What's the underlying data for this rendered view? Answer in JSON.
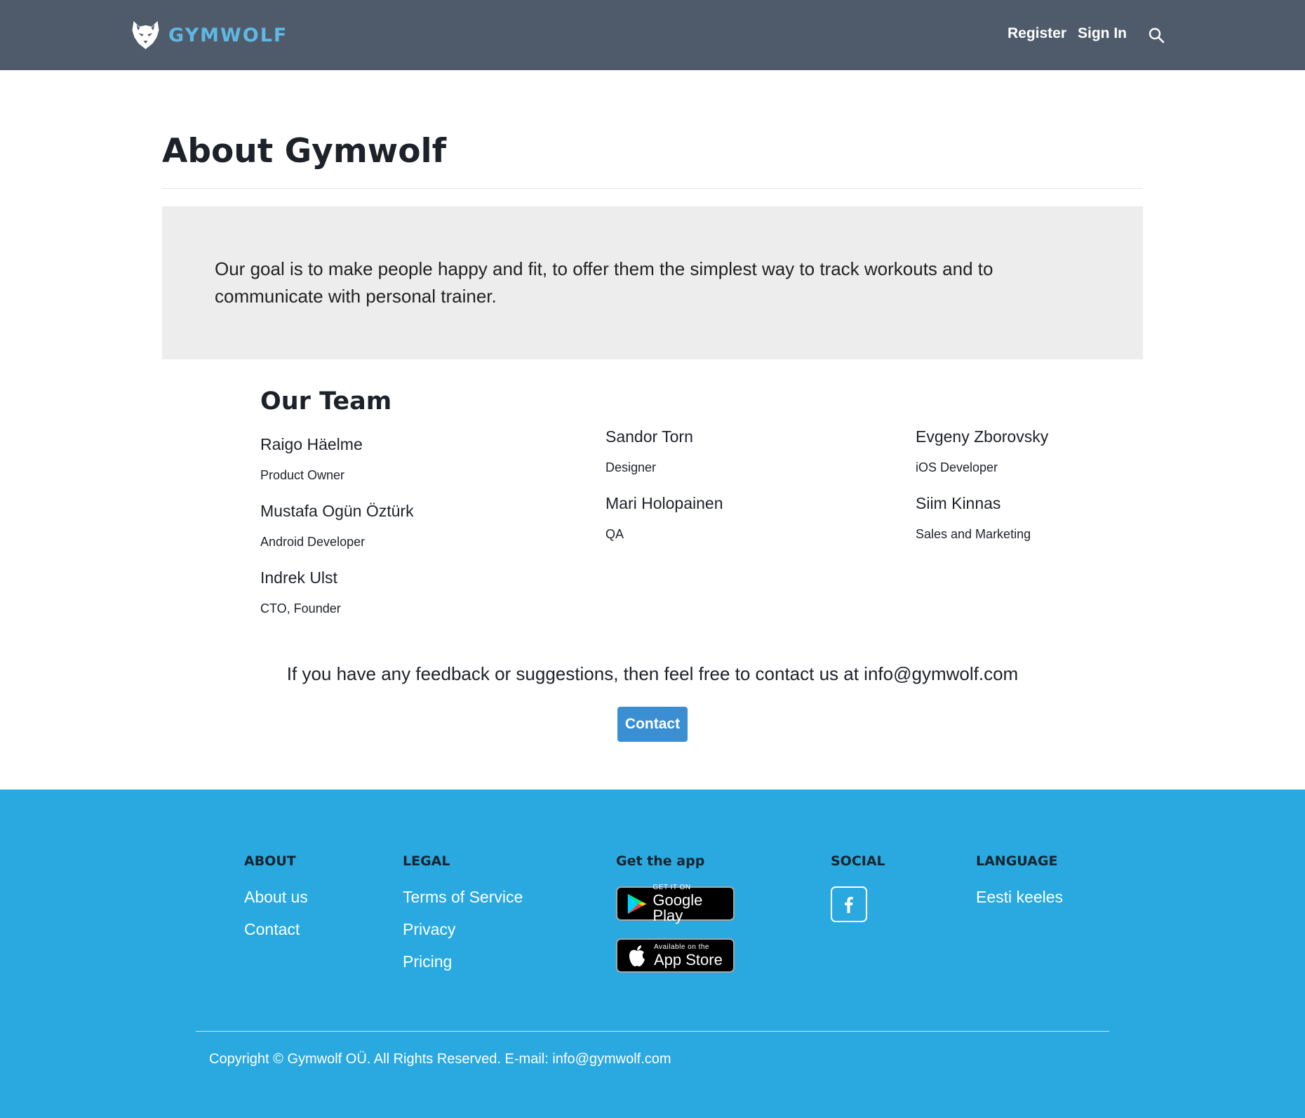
{
  "header": {
    "brand": "GYMWOLF",
    "nav": {
      "register": "Register",
      "sign_in": "Sign In"
    },
    "icons": {
      "logo": "wolf-logo-icon",
      "search": "search-icon"
    },
    "background": "#4f5b6b",
    "brand_color": "#5fb8e4"
  },
  "main": {
    "title": "About Gymwolf",
    "goal": "Our goal is to make people happy and fit, to offer them the simplest way to track workouts and to communicate with personal trainer.",
    "team_heading": "Our Team",
    "team": [
      {
        "name": "Raigo Häelme",
        "role": "Product Owner"
      },
      {
        "name": "Mustafa Ogün Öztürk",
        "role": "Android Developer"
      },
      {
        "name": "Indrek Ulst",
        "role": "CTO, Founder"
      },
      {
        "name": "Sandor Torn",
        "role": "Designer"
      },
      {
        "name": "Mari Holopainen",
        "role": "QA"
      },
      {
        "name": "Evgeny Zborovsky",
        "role": "iOS Developer"
      },
      {
        "name": "Siim Kinnas",
        "role": "Sales and Marketing"
      }
    ],
    "feedback": "If you have any feedback or suggestions, then feel free to contact us at info@gymwolf.com",
    "contact_button": "Contact",
    "accent": "#3a8fd3"
  },
  "footer": {
    "background": "#29a9e0",
    "about": {
      "heading": "ABOUT",
      "links": [
        "About us",
        "Contact"
      ]
    },
    "legal": {
      "heading": "LEGAL",
      "links": [
        "Terms of Service",
        "Privacy",
        "Pricing"
      ]
    },
    "app": {
      "heading": "Get the app",
      "google_play": {
        "small": "GET IT ON",
        "big": "Google Play",
        "icon": "google-play-icon"
      },
      "app_store": {
        "small": "Available on the",
        "big": "App Store",
        "icon": "apple-icon"
      }
    },
    "social": {
      "heading": "SOCIAL",
      "icon": "facebook-icon"
    },
    "language": {
      "heading": "LANGUAGE",
      "links": [
        "Eesti keeles"
      ]
    },
    "copyright": "Copyright © Gymwolf OÜ. All Rights Reserved. E-mail: info@gymwolf.com"
  }
}
